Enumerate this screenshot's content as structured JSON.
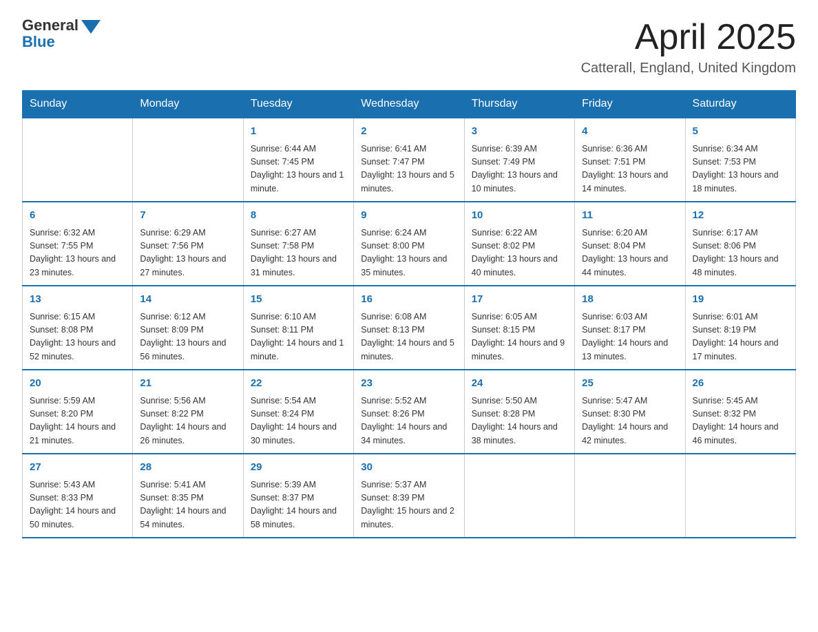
{
  "header": {
    "logo": {
      "general": "General",
      "blue": "Blue"
    },
    "title": "April 2025",
    "location": "Catterall, England, United Kingdom"
  },
  "weekdays": [
    "Sunday",
    "Monday",
    "Tuesday",
    "Wednesday",
    "Thursday",
    "Friday",
    "Saturday"
  ],
  "weeks": [
    [
      {
        "day": "",
        "info": ""
      },
      {
        "day": "",
        "info": ""
      },
      {
        "day": "1",
        "info": "Sunrise: 6:44 AM\nSunset: 7:45 PM\nDaylight: 13 hours and 1 minute."
      },
      {
        "day": "2",
        "info": "Sunrise: 6:41 AM\nSunset: 7:47 PM\nDaylight: 13 hours and 5 minutes."
      },
      {
        "day": "3",
        "info": "Sunrise: 6:39 AM\nSunset: 7:49 PM\nDaylight: 13 hours and 10 minutes."
      },
      {
        "day": "4",
        "info": "Sunrise: 6:36 AM\nSunset: 7:51 PM\nDaylight: 13 hours and 14 minutes."
      },
      {
        "day": "5",
        "info": "Sunrise: 6:34 AM\nSunset: 7:53 PM\nDaylight: 13 hours and 18 minutes."
      }
    ],
    [
      {
        "day": "6",
        "info": "Sunrise: 6:32 AM\nSunset: 7:55 PM\nDaylight: 13 hours and 23 minutes."
      },
      {
        "day": "7",
        "info": "Sunrise: 6:29 AM\nSunset: 7:56 PM\nDaylight: 13 hours and 27 minutes."
      },
      {
        "day": "8",
        "info": "Sunrise: 6:27 AM\nSunset: 7:58 PM\nDaylight: 13 hours and 31 minutes."
      },
      {
        "day": "9",
        "info": "Sunrise: 6:24 AM\nSunset: 8:00 PM\nDaylight: 13 hours and 35 minutes."
      },
      {
        "day": "10",
        "info": "Sunrise: 6:22 AM\nSunset: 8:02 PM\nDaylight: 13 hours and 40 minutes."
      },
      {
        "day": "11",
        "info": "Sunrise: 6:20 AM\nSunset: 8:04 PM\nDaylight: 13 hours and 44 minutes."
      },
      {
        "day": "12",
        "info": "Sunrise: 6:17 AM\nSunset: 8:06 PM\nDaylight: 13 hours and 48 minutes."
      }
    ],
    [
      {
        "day": "13",
        "info": "Sunrise: 6:15 AM\nSunset: 8:08 PM\nDaylight: 13 hours and 52 minutes."
      },
      {
        "day": "14",
        "info": "Sunrise: 6:12 AM\nSunset: 8:09 PM\nDaylight: 13 hours and 56 minutes."
      },
      {
        "day": "15",
        "info": "Sunrise: 6:10 AM\nSunset: 8:11 PM\nDaylight: 14 hours and 1 minute."
      },
      {
        "day": "16",
        "info": "Sunrise: 6:08 AM\nSunset: 8:13 PM\nDaylight: 14 hours and 5 minutes."
      },
      {
        "day": "17",
        "info": "Sunrise: 6:05 AM\nSunset: 8:15 PM\nDaylight: 14 hours and 9 minutes."
      },
      {
        "day": "18",
        "info": "Sunrise: 6:03 AM\nSunset: 8:17 PM\nDaylight: 14 hours and 13 minutes."
      },
      {
        "day": "19",
        "info": "Sunrise: 6:01 AM\nSunset: 8:19 PM\nDaylight: 14 hours and 17 minutes."
      }
    ],
    [
      {
        "day": "20",
        "info": "Sunrise: 5:59 AM\nSunset: 8:20 PM\nDaylight: 14 hours and 21 minutes."
      },
      {
        "day": "21",
        "info": "Sunrise: 5:56 AM\nSunset: 8:22 PM\nDaylight: 14 hours and 26 minutes."
      },
      {
        "day": "22",
        "info": "Sunrise: 5:54 AM\nSunset: 8:24 PM\nDaylight: 14 hours and 30 minutes."
      },
      {
        "day": "23",
        "info": "Sunrise: 5:52 AM\nSunset: 8:26 PM\nDaylight: 14 hours and 34 minutes."
      },
      {
        "day": "24",
        "info": "Sunrise: 5:50 AM\nSunset: 8:28 PM\nDaylight: 14 hours and 38 minutes."
      },
      {
        "day": "25",
        "info": "Sunrise: 5:47 AM\nSunset: 8:30 PM\nDaylight: 14 hours and 42 minutes."
      },
      {
        "day": "26",
        "info": "Sunrise: 5:45 AM\nSunset: 8:32 PM\nDaylight: 14 hours and 46 minutes."
      }
    ],
    [
      {
        "day": "27",
        "info": "Sunrise: 5:43 AM\nSunset: 8:33 PM\nDaylight: 14 hours and 50 minutes."
      },
      {
        "day": "28",
        "info": "Sunrise: 5:41 AM\nSunset: 8:35 PM\nDaylight: 14 hours and 54 minutes."
      },
      {
        "day": "29",
        "info": "Sunrise: 5:39 AM\nSunset: 8:37 PM\nDaylight: 14 hours and 58 minutes."
      },
      {
        "day": "30",
        "info": "Sunrise: 5:37 AM\nSunset: 8:39 PM\nDaylight: 15 hours and 2 minutes."
      },
      {
        "day": "",
        "info": ""
      },
      {
        "day": "",
        "info": ""
      },
      {
        "day": "",
        "info": ""
      }
    ]
  ]
}
